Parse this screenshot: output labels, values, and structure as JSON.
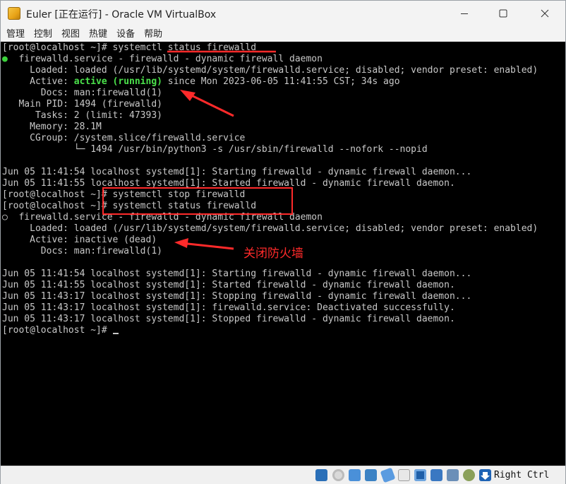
{
  "window": {
    "title": "Euler [正在运行] - Oracle VM VirtualBox",
    "icon": "virtualbox-app-icon"
  },
  "menu": [
    "管理",
    "控制",
    "视图",
    "热键",
    "设备",
    "帮助"
  ],
  "terminal": {
    "lines": [
      "[root@localhost ~]# systemctl status firewalld",
      "  firewalld.service - firewalld - dynamic firewall daemon",
      "     Loaded: loaded (/usr/lib/systemd/system/firewalld.service; disabled; vendor preset: enabled)",
      "     Active: ",
      "       Docs: man:firewalld(1)",
      "   Main PID: 1494 (firewalld)",
      "      Tasks: 2 (limit: 47393)",
      "     Memory: 28.1M",
      "     CGroup: /system.slice/firewalld.service",
      "             └─ 1494 /usr/bin/python3 -s /usr/sbin/firewalld --nofork --nopid",
      "",
      "Jun 05 11:41:54 localhost systemd[1]: Starting firewalld - dynamic firewall daemon...",
      "Jun 05 11:41:55 localhost systemd[1]: Started firewalld - dynamic firewall daemon.",
      "[root@localhost ~]# systemctl stop firewalld",
      "[root@localhost ~]# systemctl status firewalld",
      "  firewalld.service - firewalld - dynamic firewall daemon",
      "     Loaded: loaded (/usr/lib/systemd/system/firewalld.service; disabled; vendor preset: enabled)",
      "     Active: inactive (dead)",
      "       Docs: man:firewalld(1)",
      "",
      "Jun 05 11:41:54 localhost systemd[1]: Starting firewalld - dynamic firewall daemon...",
      "Jun 05 11:41:55 localhost systemd[1]: Started firewalld - dynamic firewall daemon.",
      "Jun 05 11:43:17 localhost systemd[1]: Stopping firewalld - dynamic firewall daemon...",
      "Jun 05 11:43:17 localhost systemd[1]: firewalld.service: Deactivated successfully.",
      "Jun 05 11:43:17 localhost systemd[1]: Stopped firewalld - dynamic firewall daemon.",
      "[root@localhost ~]# "
    ],
    "active_running_label": "active (running)",
    "active_running_rest": " since Mon 2023-06-05 11:41:55 CST; 34s ago",
    "status_dot_active": "●",
    "status_dot_inactive": "○"
  },
  "annotation": {
    "label": "关闭防火墙",
    "color": "#ff2a2a"
  },
  "statusbar": {
    "host_key": "Right Ctrl",
    "icons": [
      "hard-disk-icon",
      "optical-drive-icon",
      "audio-icon",
      "network-icon",
      "usb-icon",
      "shared-folder-icon",
      "display-icon",
      "recording-icon",
      "mouse-integration-icon",
      "keyboard-capture-icon",
      "arrow-down-icon"
    ]
  },
  "colors": {
    "terminal_bg": "#000000",
    "terminal_fg": "#c8c8c8",
    "running_green": "#4be14b",
    "window_chrome": "#f3f3f3"
  }
}
